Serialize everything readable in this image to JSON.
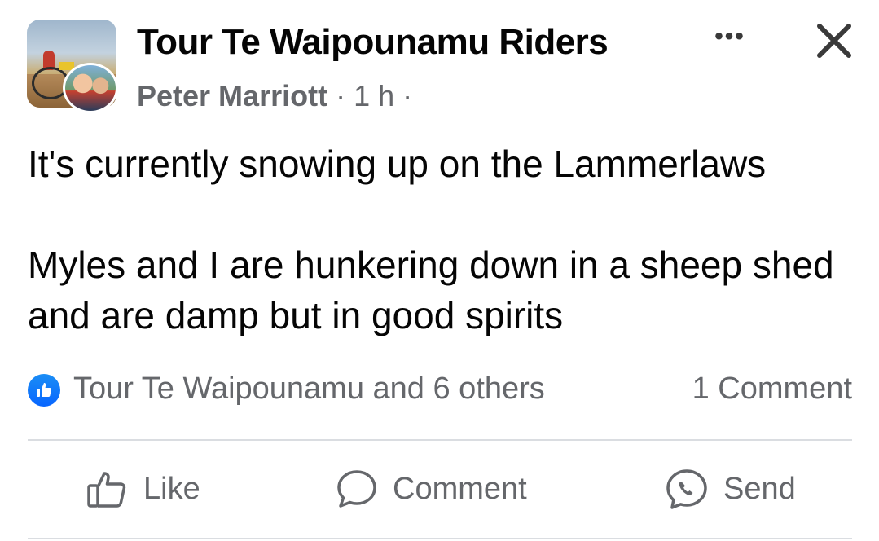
{
  "post": {
    "group_name": "Tour Te Waipounamu Riders",
    "author": "Peter Marriott",
    "separator": "·",
    "time": "1 h",
    "more_label": "•••",
    "text_line_1": "It's currently snowing up on the Lammerlaws",
    "text_line_2": "Myles and I are hunkering down in a sheep shed and are damp but in good spirits"
  },
  "stats": {
    "reactors": "Tour Te Waipounamu and 6 others",
    "comments": "1 Comment"
  },
  "actions": {
    "like": "Like",
    "comment": "Comment",
    "send": "Send"
  },
  "icons": {
    "like_badge": "thumbs-up-icon",
    "like": "thumbs-up-outline-icon",
    "comment": "speech-bubble-icon",
    "send": "messenger-icon",
    "close": "close-icon",
    "more": "more-horizontal-icon"
  },
  "colors": {
    "text_primary": "#050505",
    "text_secondary": "#65676b",
    "like_blue": "#0866ff",
    "divider": "#dadde1"
  }
}
